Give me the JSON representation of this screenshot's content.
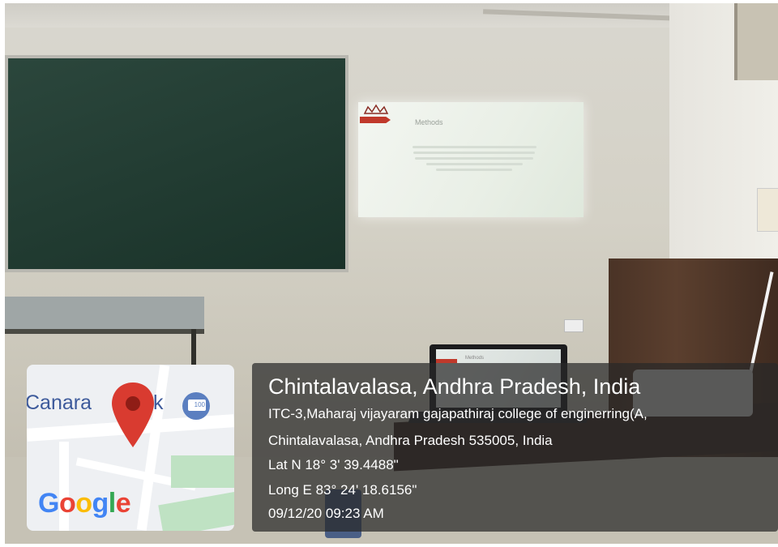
{
  "scene": {
    "projection_title": "Methods",
    "laptop_slide_title": "Methods"
  },
  "map": {
    "place_label_left": "Canara",
    "place_label_right": "k",
    "poi_badge": "100",
    "brand": "Google",
    "brand_colors": [
      "#4285F4",
      "#EA4335",
      "#FBBC05",
      "#4285F4",
      "#34A853",
      "#EA4335"
    ],
    "pin_color": "#D93B30",
    "icons": [
      "map-pin-icon",
      "poi-badge-icon"
    ]
  },
  "overlay": {
    "title": "Chintalavalasa, Andhra Pradesh, India",
    "address_line1": "ITC-3,Maharaj vijayaram gajapathiraj college of enginerring(A,",
    "address_line2": "Chintalavalasa, Andhra Pradesh 535005, India",
    "latitude": "Lat N 18° 3' 39.4488\"",
    "longitude": "Long E 83° 24' 18.6156\"",
    "timestamp": "09/12/20 09:23 AM"
  }
}
